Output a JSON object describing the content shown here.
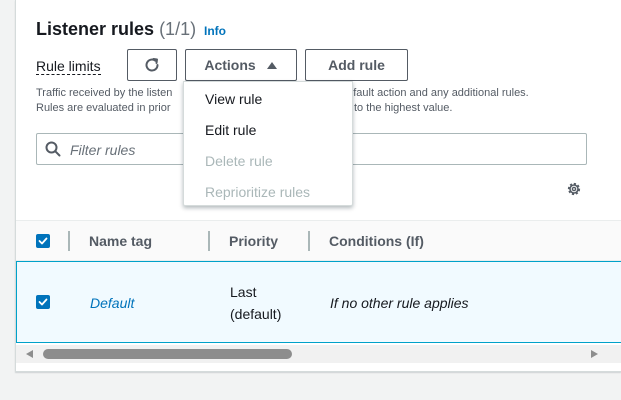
{
  "header": {
    "title": "Listener rules",
    "count": "(1/1)",
    "info_label": "Info"
  },
  "toolbar": {
    "rule_limits_label": "Rule limits",
    "refresh_icon": "refresh-icon",
    "actions_label": "Actions",
    "add_rule_label": "Add rule"
  },
  "description": {
    "line1_left": "Traffic received by the listen",
    "line1_right": "default action and any additional rules.",
    "line2_left": "Rules are evaluated in prior",
    "line2_right": "to the highest value."
  },
  "search": {
    "placeholder": "Filter rules"
  },
  "actions_menu": {
    "items": [
      {
        "label": "View rule",
        "enabled": true
      },
      {
        "label": "Edit rule",
        "enabled": true
      },
      {
        "label": "Delete rule",
        "enabled": false
      },
      {
        "label": "Reprioritize rules",
        "enabled": false
      }
    ]
  },
  "table": {
    "columns": [
      "Name tag",
      "Priority",
      "Conditions (If)"
    ],
    "rows": [
      {
        "selected": true,
        "name_tag": "Default",
        "priority_line1": "Last",
        "priority_line2": "(default)",
        "conditions": "If no other rule applies"
      }
    ]
  },
  "colors": {
    "accent": "#0073bb",
    "selected_row_bg": "#f1faff",
    "selected_row_border": "#00a1c9",
    "disabled_text": "#aab7b8"
  }
}
